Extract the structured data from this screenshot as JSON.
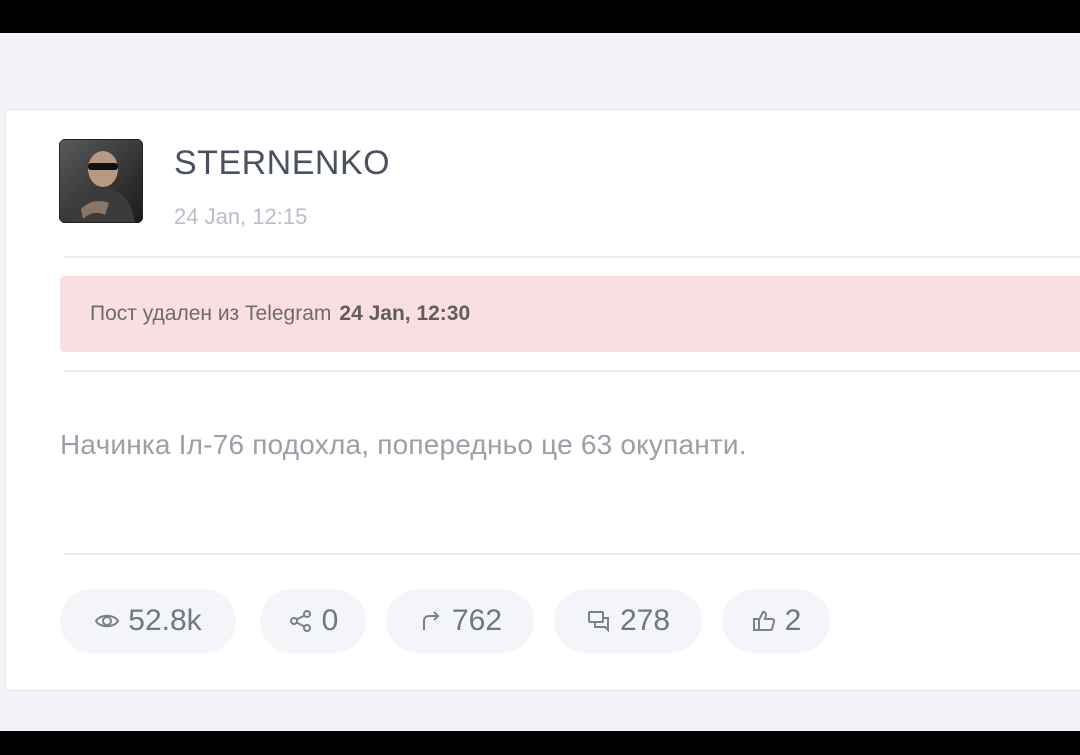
{
  "post": {
    "author": "STERNENKO",
    "date": "24 Jan, 12:15",
    "deleted_notice": {
      "text": "Пост удален из Telegram",
      "time": "24 Jan, 12:30"
    },
    "body": "Начинка Іл-76 подохла, попередньо це 63 окупанти."
  },
  "stats": {
    "views": "52.8k",
    "shares": "0",
    "forwards": "762",
    "comments": "278",
    "likes": "2"
  },
  "icons": {
    "views": "eye-icon",
    "shares": "share-icon",
    "forwards": "forward-arrow-icon",
    "comments": "comments-icon",
    "likes": "thumbs-up-icon"
  },
  "colors": {
    "banner_background": "#f9dfe1",
    "page_background": "#f1f3f7",
    "card_background": "#ffffff"
  }
}
